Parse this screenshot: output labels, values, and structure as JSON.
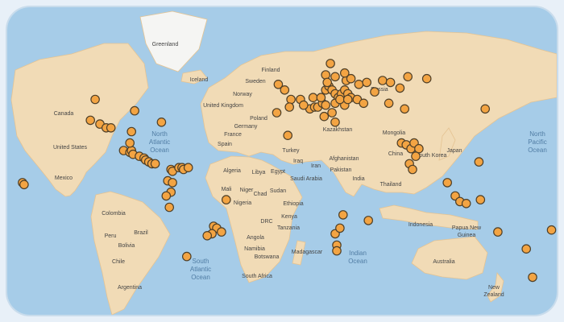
{
  "colors": {
    "ocean": "#9cc7e6",
    "land": "#f0d7ae",
    "land_dark": "#e2bd86",
    "ice": "#f4f4f2",
    "marker_fill": "#f29a2e",
    "marker_stroke": "#3a2a10"
  },
  "countries": [
    {
      "id": "greenland",
      "name": "Greenland"
    },
    {
      "id": "iceland",
      "name": "Iceland"
    },
    {
      "id": "finland",
      "name": "Finland"
    },
    {
      "id": "sweden",
      "name": "Sweden"
    },
    {
      "id": "norway",
      "name": "Norway"
    },
    {
      "id": "russia",
      "name": "Russia"
    },
    {
      "id": "canada",
      "name": "Canada"
    },
    {
      "id": "united-kingdom",
      "name": "United Kingdom"
    },
    {
      "id": "poland",
      "name": "Poland"
    },
    {
      "id": "germany",
      "name": "Germany"
    },
    {
      "id": "france",
      "name": "France"
    },
    {
      "id": "spain",
      "name": "Spain"
    },
    {
      "id": "kazakhstan",
      "name": "Kazakhstan"
    },
    {
      "id": "mongolia",
      "name": "Mongolia"
    },
    {
      "id": "united-states",
      "name": "United States"
    },
    {
      "id": "turkey",
      "name": "Turkey"
    },
    {
      "id": "japan",
      "name": "Japan"
    },
    {
      "id": "south-korea",
      "name": "South Korea"
    },
    {
      "id": "china",
      "name": "China"
    },
    {
      "id": "iraq",
      "name": "Iraq"
    },
    {
      "id": "afghanistan",
      "name": "Afghanistan"
    },
    {
      "id": "iran",
      "name": "Iran"
    },
    {
      "id": "algeria",
      "name": "Algeria"
    },
    {
      "id": "libya",
      "name": "Libya"
    },
    {
      "id": "egypt",
      "name": "Egypt"
    },
    {
      "id": "pakistan",
      "name": "Pakistan"
    },
    {
      "id": "saudi-arabia",
      "name": "Saudi Arabia"
    },
    {
      "id": "mexico",
      "name": "Mexico"
    },
    {
      "id": "india",
      "name": "India"
    },
    {
      "id": "mali",
      "name": "Mali"
    },
    {
      "id": "niger",
      "name": "Niger"
    },
    {
      "id": "chad",
      "name": "Chad"
    },
    {
      "id": "sudan",
      "name": "Sudan"
    },
    {
      "id": "thailand",
      "name": "Thailand"
    },
    {
      "id": "nigeria",
      "name": "Nigeria"
    },
    {
      "id": "ethiopia",
      "name": "Ethiopia"
    },
    {
      "id": "colombia",
      "name": "Colombia"
    },
    {
      "id": "drc",
      "name": "DRC"
    },
    {
      "id": "kenya",
      "name": "Kenya"
    },
    {
      "id": "tanzania",
      "name": "Tanzania"
    },
    {
      "id": "indonesia",
      "name": "Indonesia"
    },
    {
      "id": "papua-new-guinea-1",
      "name": "Papua New"
    },
    {
      "id": "papua-new-guinea-2",
      "name": "Guinea"
    },
    {
      "id": "brazil",
      "name": "Brazil"
    },
    {
      "id": "peru",
      "name": "Peru"
    },
    {
      "id": "angola",
      "name": "Angola"
    },
    {
      "id": "bolivia",
      "name": "Bolivia"
    },
    {
      "id": "namibia",
      "name": "Namibia"
    },
    {
      "id": "madagascar",
      "name": "Madagascar"
    },
    {
      "id": "botswana",
      "name": "Botswana"
    },
    {
      "id": "australia",
      "name": "Australia"
    },
    {
      "id": "chile",
      "name": "Chile"
    },
    {
      "id": "south-africa",
      "name": "South Africa"
    },
    {
      "id": "new-zealand-1",
      "name": "New"
    },
    {
      "id": "new-zealand-2",
      "name": "Zealand"
    },
    {
      "id": "argentina",
      "name": "Argentina"
    }
  ],
  "oceans": [
    {
      "id": "north-atlantic",
      "lines": [
        "North",
        "Atlantic",
        "Ocean"
      ]
    },
    {
      "id": "north-pacific",
      "lines": [
        "North",
        "Pacific",
        "Ocean"
      ]
    },
    {
      "id": "south-atlantic",
      "lines": [
        "South",
        "Atlantic",
        "Ocean"
      ]
    },
    {
      "id": "indian",
      "lines": [
        "Indian",
        "Ocean"
      ]
    }
  ],
  "markers": [
    {
      "lng": -125,
      "lat": 36
    },
    {
      "lng": -119,
      "lat": 34
    },
    {
      "lng": -115,
      "lat": 32
    },
    {
      "lng": -122,
      "lat": 47
    },
    {
      "lng": -112,
      "lat": 32
    },
    {
      "lng": -99,
      "lat": 30
    },
    {
      "lng": -80,
      "lat": 35
    },
    {
      "lng": -97,
      "lat": 41
    },
    {
      "lng": -104,
      "lat": 20
    },
    {
      "lng": -100,
      "lat": 19
    },
    {
      "lng": -99,
      "lat": 20
    },
    {
      "lng": -98,
      "lat": 18
    },
    {
      "lng": -94,
      "lat": 17
    },
    {
      "lng": -91,
      "lat": 16
    },
    {
      "lng": -90,
      "lat": 15
    },
    {
      "lng": -88,
      "lat": 14
    },
    {
      "lng": -86,
      "lat": 13
    },
    {
      "lng": -84,
      "lat": 13
    },
    {
      "lng": -100,
      "lat": 24
    },
    {
      "lng": -74,
      "lat": 10
    },
    {
      "lng": -73,
      "lat": 9
    },
    {
      "lng": -69,
      "lat": 11
    },
    {
      "lng": -67,
      "lat": 11
    },
    {
      "lng": -66,
      "lat": 10
    },
    {
      "lng": -63,
      "lat": 11
    },
    {
      "lng": -76,
      "lat": 4
    },
    {
      "lng": -73,
      "lat": 3
    },
    {
      "lng": -74,
      "lat": -2
    },
    {
      "lng": -77,
      "lat": -4
    },
    {
      "lng": -75,
      "lat": -10
    },
    {
      "lng": -39,
      "lat": -6
    },
    {
      "lng": -47,
      "lat": -20
    },
    {
      "lng": -45,
      "lat": -21
    },
    {
      "lng": -42,
      "lat": -23
    },
    {
      "lng": -48,
      "lat": -24
    },
    {
      "lng": -51,
      "lat": -25
    },
    {
      "lng": -64,
      "lat": -36
    },
    {
      "lng": -6,
      "lat": 55
    },
    {
      "lng": -2,
      "lat": 52
    },
    {
      "lng": 2,
      "lat": 47
    },
    {
      "lng": -7,
      "lat": 40
    },
    {
      "lng": 1,
      "lat": 43
    },
    {
      "lng": 8,
      "lat": 47
    },
    {
      "lng": 14,
      "lat": 42
    },
    {
      "lng": 10,
      "lat": 44
    },
    {
      "lng": 16,
      "lat": 48
    },
    {
      "lng": 17,
      "lat": 43
    },
    {
      "lng": 19,
      "lat": 43
    },
    {
      "lng": 22,
      "lat": 45
    },
    {
      "lng": 24,
      "lat": 44
    },
    {
      "lng": 21,
      "lat": 48
    },
    {
      "lng": 24,
      "lat": 52
    },
    {
      "lng": 26,
      "lat": 54
    },
    {
      "lng": 28,
      "lat": 52
    },
    {
      "lng": 30,
      "lat": 50
    },
    {
      "lng": 32,
      "lat": 48
    },
    {
      "lng": 34,
      "lat": 50
    },
    {
      "lng": 36,
      "lat": 52
    },
    {
      "lng": 38,
      "lat": 50
    },
    {
      "lng": 40,
      "lat": 48
    },
    {
      "lng": 30,
      "lat": 45
    },
    {
      "lng": 36,
      "lat": 44
    },
    {
      "lng": 28,
      "lat": 40
    },
    {
      "lng": 23,
      "lat": 38
    },
    {
      "lng": 33,
      "lat": 47
    },
    {
      "lng": 38,
      "lat": 47
    },
    {
      "lng": 44,
      "lat": 47
    },
    {
      "lng": 48,
      "lat": 45
    },
    {
      "lng": 55,
      "lat": 51
    },
    {
      "lng": 45,
      "lat": 55
    },
    {
      "lng": 50,
      "lat": 56
    },
    {
      "lng": 37,
      "lat": 57
    },
    {
      "lng": 30,
      "lat": 59
    },
    {
      "lng": 24,
      "lat": 60
    },
    {
      "lng": 27,
      "lat": 66
    },
    {
      "lng": 36,
      "lat": 61
    },
    {
      "lng": 25,
      "lat": 56
    },
    {
      "lng": 60,
      "lat": 57
    },
    {
      "lng": 76,
      "lat": 59
    },
    {
      "lng": 64,
      "lat": 45
    },
    {
      "lng": 71,
      "lat": 53
    },
    {
      "lng": 88,
      "lat": 58
    },
    {
      "lng": 30,
      "lat": 35
    },
    {
      "lng": 65,
      "lat": 56
    },
    {
      "lng": 40,
      "lat": 58
    },
    {
      "lng": 74,
      "lat": 42
    },
    {
      "lng": 125,
      "lat": 42
    },
    {
      "lng": 72,
      "lat": 24
    },
    {
      "lng": 75,
      "lat": 23
    },
    {
      "lng": 78,
      "lat": 21
    },
    {
      "lng": 80,
      "lat": 24
    },
    {
      "lng": 83,
      "lat": 21
    },
    {
      "lng": 81,
      "lat": 17
    },
    {
      "lng": 77,
      "lat": 13
    },
    {
      "lng": 79,
      "lat": 10
    },
    {
      "lng": 121,
      "lat": 14
    },
    {
      "lng": 101,
      "lat": 3
    },
    {
      "lng": 106,
      "lat": -4
    },
    {
      "lng": 109,
      "lat": -7
    },
    {
      "lng": 113,
      "lat": -8
    },
    {
      "lng": 122,
      "lat": -6
    },
    {
      "lng": 133,
      "lat": -23
    },
    {
      "lng": 151,
      "lat": -32
    },
    {
      "lng": 167,
      "lat": -22
    },
    {
      "lng": 155,
      "lat": -47
    },
    {
      "lng": -168,
      "lat": 3
    },
    {
      "lng": -167,
      "lat": 2
    },
    {
      "lng": 30,
      "lat": -24
    },
    {
      "lng": 33,
      "lat": -21
    },
    {
      "lng": 31,
      "lat": -30
    },
    {
      "lng": 31,
      "lat": -33
    },
    {
      "lng": 51,
      "lat": -17
    },
    {
      "lng": 35,
      "lat": -14
    },
    {
      "lng": 0,
      "lat": 28
    }
  ]
}
